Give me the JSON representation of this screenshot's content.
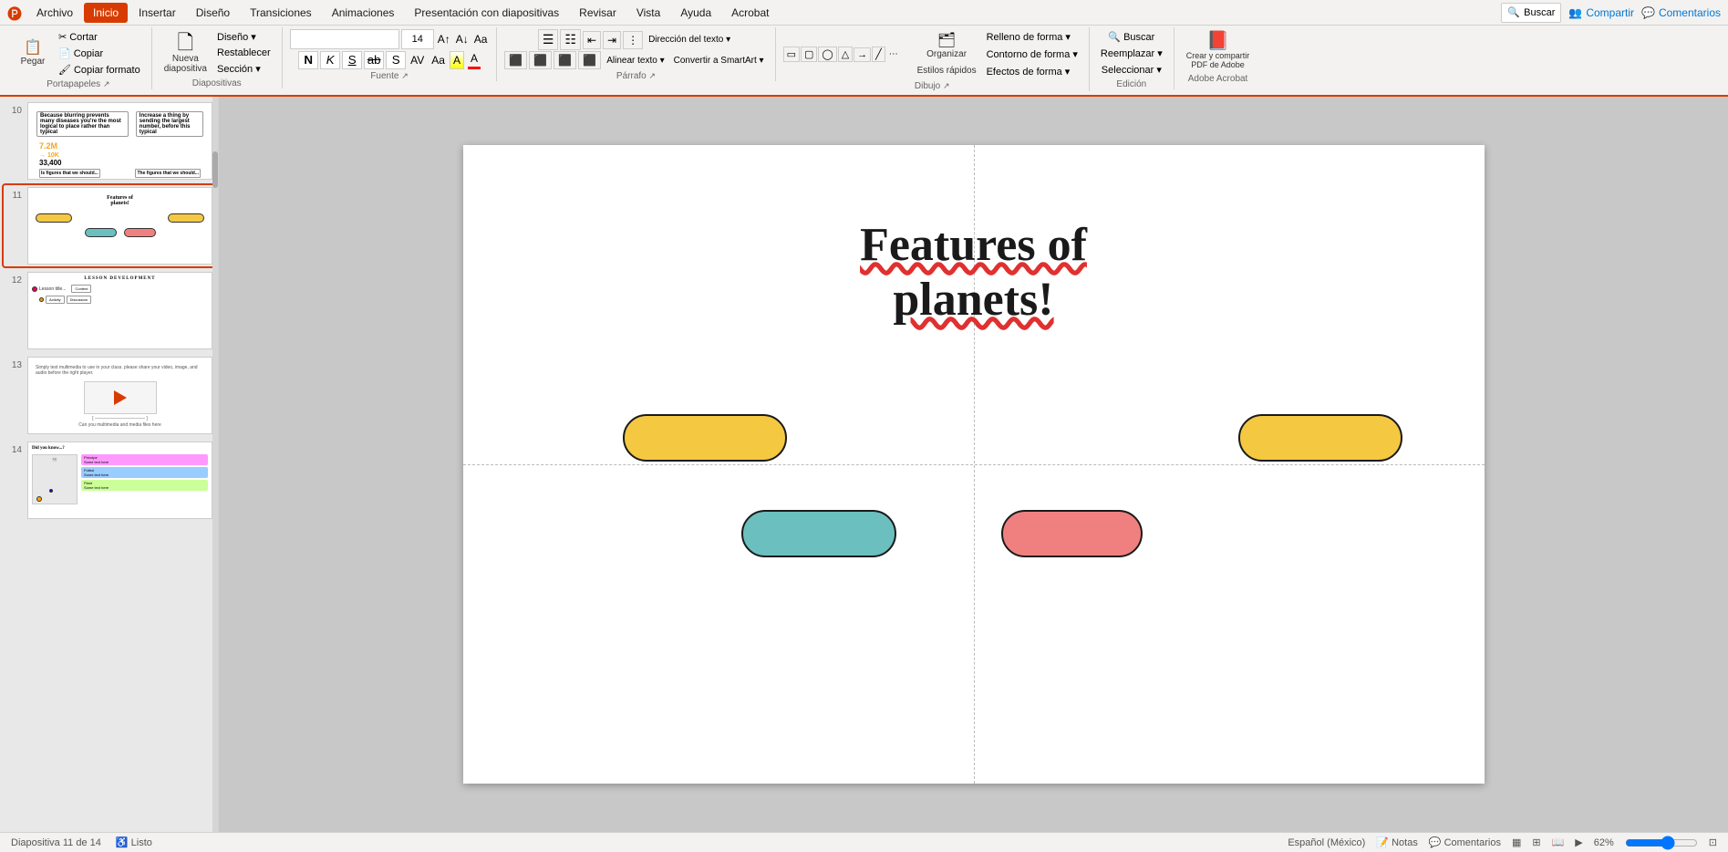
{
  "app": {
    "title": "PowerPoint"
  },
  "menu": {
    "items": [
      "Archivo",
      "Inicio",
      "Insertar",
      "Diseño",
      "Transiciones",
      "Animaciones",
      "Presentación con diapositivas",
      "Revisar",
      "Vista",
      "Ayuda",
      "Acrobat"
    ],
    "active_index": 1,
    "search_placeholder": "Buscar",
    "share_label": "Compartir",
    "comments_label": "Comentarios"
  },
  "ribbon": {
    "groups": [
      {
        "name": "Portapapeles",
        "buttons": [
          "Pegar",
          "Cortar",
          "Copiar",
          "Copiar formato",
          "Restablecer"
        ]
      },
      {
        "name": "Diapositivas",
        "buttons": [
          "Nueva diapositiva",
          "Diseño",
          "Sección"
        ]
      },
      {
        "name": "Fuente",
        "font_name": "",
        "font_size": "14",
        "buttons": [
          "N",
          "K",
          "S",
          "ab",
          "S",
          "Aa",
          "A",
          "A"
        ]
      },
      {
        "name": "Párrafo",
        "buttons": [
          "≡",
          "≡",
          "≡",
          "≡"
        ]
      },
      {
        "name": "Dibujo",
        "buttons": [
          "Organizar",
          "Estilos rápidos"
        ]
      },
      {
        "name": "Edición",
        "buttons": [
          "Buscar",
          "Reemplazar",
          "Seleccionar"
        ]
      },
      {
        "name": "Adobe Acrobat",
        "buttons": [
          "Crear y compartir PDF de Adobe"
        ]
      }
    ]
  },
  "slides": [
    {
      "number": 10,
      "type": "stats",
      "preview_items": [
        "7.2M",
        "10K",
        "33,400"
      ]
    },
    {
      "number": 11,
      "type": "features",
      "active": true,
      "preview_title": "Features of planets!"
    },
    {
      "number": 12,
      "type": "lesson",
      "preview_title": "Lesson Development"
    },
    {
      "number": 13,
      "type": "video",
      "preview_title": ""
    },
    {
      "number": 14,
      "type": "facts",
      "preview_title": "Did you know...?"
    }
  ],
  "canvas": {
    "slide_title_line1": "Features of",
    "slide_title_line2": "planets!",
    "pills": [
      {
        "id": "yellow-left",
        "color": "#f5c842",
        "label": ""
      },
      {
        "id": "yellow-right",
        "color": "#f5c842",
        "label": ""
      },
      {
        "id": "teal",
        "color": "#6bbfbf",
        "label": ""
      },
      {
        "id": "pink",
        "color": "#f08080",
        "label": ""
      }
    ]
  },
  "status_bar": {
    "slide_info": "Diapositiva 11 de 14",
    "language": "Español (México)",
    "accessibility": "Listo",
    "zoom": "62%"
  },
  "icons": {
    "paste": "📋",
    "cut": "✂",
    "copy": "📄",
    "format_painter": "🖌",
    "new_slide": "➕",
    "search": "🔍",
    "share": "👥",
    "comments": "💬",
    "pdf": "📄"
  }
}
